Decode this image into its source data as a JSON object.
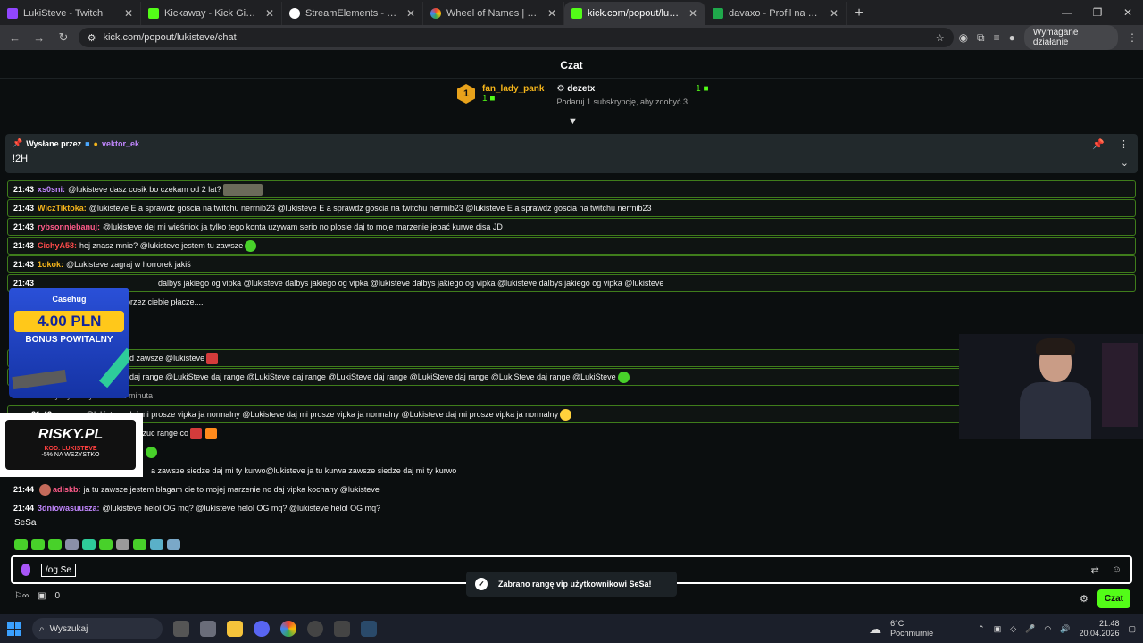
{
  "browser": {
    "tabs": [
      {
        "label": "LukiSteve - Twitch",
        "color": "#9146ff"
      },
      {
        "label": "Kickaway - Kick Giveaway Tool",
        "color": "#53fc18"
      },
      {
        "label": "StreamElements - Giveaways",
        "color": "#ffffff"
      },
      {
        "label": "Wheel of Names | Random nam",
        "color": "#ea4335"
      },
      {
        "label": "kick.com/popout/lukisteve/chat",
        "color": "#53fc18",
        "active": true
      },
      {
        "label": "davaxo - Profil na Kick",
        "color": "#1fa84b"
      }
    ],
    "url": "kick.com/popout/lukisteve/chat",
    "action_required": "Wymagane działanie"
  },
  "chat": {
    "header": "Czat",
    "leaderboard": [
      {
        "rank": "1",
        "name": "fan_lady_pank",
        "count": "1"
      },
      {
        "name": "dezetx",
        "count": "1",
        "hint": "Podaruj 1 subskrypcję, aby zdobyć 3."
      }
    ],
    "pinned": {
      "prefix": "Wysłane przez",
      "user": "vektor_ek",
      "message": "!2H"
    },
    "messages": [
      {
        "time": "21:43",
        "user": "xs0sni:",
        "color": "#c287ff",
        "text": "@lukisteve dasz cosik bo czekam od 2 lat?"
      },
      {
        "time": "21:43",
        "user": "WiczTiktoka:",
        "color": "#f5b51b",
        "text": "@lukisteve E a sprawdz goscia na twitchu nerrnib23 @lukisteve E a sprawdz goscia na twitchu nerrnib23 @lukisteve E a sprawdz goscia na twitchu nerrnib23"
      },
      {
        "time": "21:43",
        "user": "rybsonniebanuj:",
        "color": "#ff5b8a",
        "text": "@lukisteve dej mi wieśniok ja tylko tego konta uzywam serio no plosie daj to moje marzenie jebać kurwe disa JD"
      },
      {
        "time": "21:43",
        "user": "CichyA58:",
        "color": "#ff4b4b",
        "text": "hej znasz mnie? @lukisteve jestem tu zawsze"
      },
      {
        "time": "21:43",
        "user": "1okok:",
        "color": "#f5b51b",
        "text": "@Lukisteve zagraj w horrorek jakiś"
      },
      {
        "time": "21:43",
        "user": "",
        "color": "#c287ff",
        "text": "dalbys jakiego og vipka @lukisteve dalbys jakiego og vipka @lukisteve dalbys jakiego og vipka @lukisteve dalbys jakiego og vipka @lukisteve"
      },
      {
        "time": "",
        "user": "",
        "color": "#ffffff",
        "text": "przez ciebie płacze...."
      },
      {
        "time": "",
        "user": "",
        "color": "#ffffff",
        "text": "d zawsze @lukisteve"
      },
      {
        "time": "",
        "user": "",
        "color": "#ffffff",
        "text": "daj range @LukiSteve daj range @LukiSteve daj range @LukiSteve daj range @LukiSteve daj range @LukiSteve daj range @LukiSteve"
      },
      {
        "time": "",
        "user": "",
        "color": "#aaaaaa",
        "text": "zyczył ferdynant na 1 minuta"
      },
      {
        "time": "21:43",
        "user": "",
        "color": "#ff5b8a",
        "text": "@lukisteve daj mi prosze vipka ja normalny @Lukisteve daj mi prosze vipka ja normalny @Lukisteve daj mi prosze vipka ja normalny"
      },
      {
        "time": "",
        "user": "",
        "color": "#ffffff",
        "text": "zarzuc range co"
      },
      {
        "time": "",
        "user": "",
        "color": "#ffffff",
        "text": ""
      },
      {
        "time": "",
        "user": "",
        "color": "#ffffff",
        "text": "a zawsze siedze daj mi ty kurwo@lukisteve ja tu kurwa zawsze siedze daj mi ty kurwo"
      },
      {
        "time": "21:44",
        "user": "adiskb:",
        "color": "#ff5b8a",
        "text": "ja tu zawsze jestem blagam cie to mojej marzenie no daj vipka kochany @lukisteve"
      },
      {
        "time": "21:44",
        "user": "3dniowasuusza:",
        "color": "#c287ff",
        "text": "@lukisteve helol OG mq? @lukisteve helol OG mq? @lukisteve helol OG mq?"
      }
    ],
    "replying_to": "SeSa",
    "input_value": "/og Se",
    "toast": "Zabrano rangę vip użytkownikowi SeSa!",
    "points": "0",
    "send_label": "Czat"
  },
  "overlays": {
    "casino_brand": "Casehug",
    "casino_amount": "4.00 PLN",
    "casino_bonus": "BONUS POWITALNY",
    "risky_logo": "RISKY.PL",
    "risky_code": "KOD: LUKISTEVE",
    "risky_discount": "-5% NA WSZYSTKO"
  },
  "taskbar": {
    "search_placeholder": "Wyszukaj",
    "weather_temp": "6°C",
    "weather_desc": "Pochmurnie",
    "time": "21:48",
    "date": "20.04.2026"
  }
}
